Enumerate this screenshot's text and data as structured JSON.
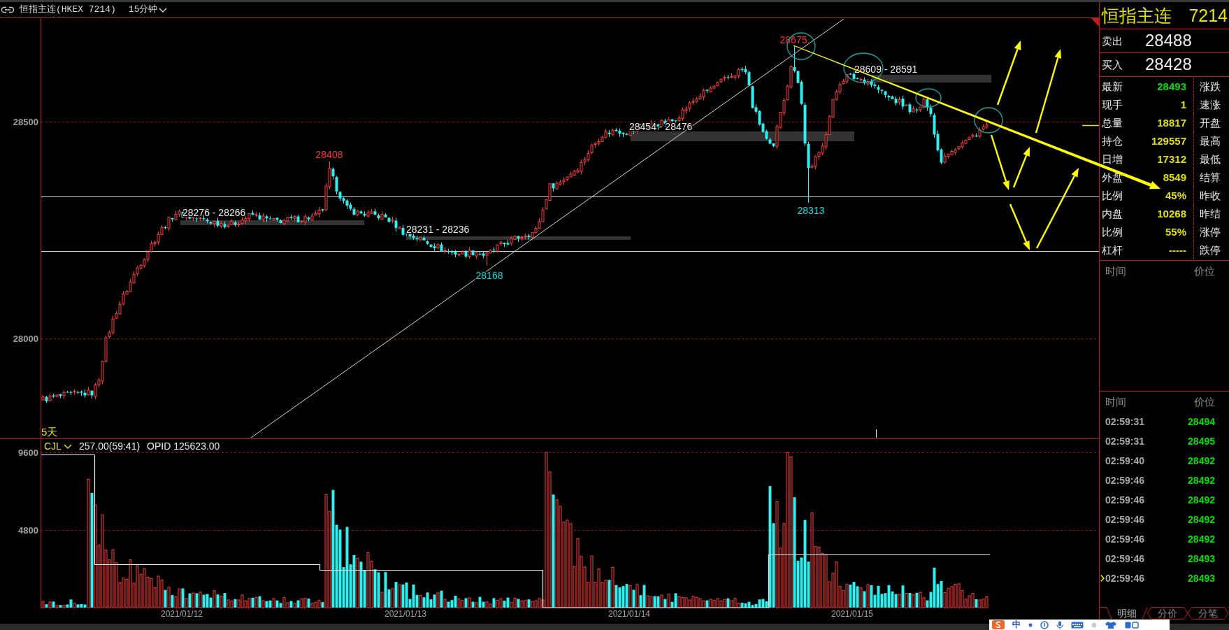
{
  "header": {
    "title": "恒指主连(HKEX 7214)",
    "period": "15分钟"
  },
  "price_chart": {
    "y_ticks": [
      "28500",
      "28000"
    ],
    "extreme_labels": [
      {
        "text": "28408",
        "kind": "high"
      },
      {
        "text": "28168",
        "kind": "low"
      },
      {
        "text": "28675",
        "kind": "high"
      },
      {
        "text": "28313",
        "kind": "low"
      }
    ],
    "range_labels": [
      "28276 - 28266",
      "28231 - 28236",
      "28454 - 28476",
      "28609 - 28591"
    ],
    "period_label": "5天"
  },
  "volume_chart": {
    "indicator": "CJL",
    "reading": "257.00(59:41)",
    "open_interest": "OPID 125623.00",
    "y_ticks": [
      "9600",
      "4800"
    ]
  },
  "x_axis": {
    "dates": [
      "2021/01/12",
      "2021/01/13",
      "2021/01/14",
      "2021/01/15"
    ]
  },
  "quote": {
    "name": "恒指主连",
    "code": "7214",
    "ask": {
      "label": "卖出",
      "value": "28488"
    },
    "bid": {
      "label": "买入",
      "value": "28428"
    },
    "rows": [
      {
        "label": "最新",
        "value": "28493",
        "color": "#00e000",
        "label_2": "涨跌"
      },
      {
        "label": "现手",
        "value": "1",
        "color": "#e0e000",
        "label_2": "速涨"
      },
      {
        "label": "总量",
        "value": "18817",
        "color": "#e0e000",
        "label_2": "开盘"
      },
      {
        "label": "持仓",
        "value": "129557",
        "color": "#e0e000",
        "label_2": "最高"
      },
      {
        "label": "日增",
        "value": "17312",
        "color": "#e0e000",
        "label_2": "最低"
      },
      {
        "label": "外盘",
        "value": "8549",
        "color": "#e0e000",
        "label_2": "结算"
      },
      {
        "label": "比例",
        "value": "45%",
        "color": "#e0e000",
        "label_2": "昨收"
      },
      {
        "label": "内盘",
        "value": "10268",
        "color": "#e0e000",
        "label_2": "昨结"
      },
      {
        "label": "比例",
        "value": "55%",
        "color": "#e0e000",
        "label_2": "涨停"
      },
      {
        "label": "杠杆",
        "value": "-----",
        "color": "#e0e000",
        "label_2": "跌停"
      }
    ]
  },
  "top_list": {
    "columns": [
      "时间",
      "价位"
    ]
  },
  "time_sales": {
    "columns": [
      "时间",
      "价位"
    ],
    "rows": [
      {
        "time": "02:59:31",
        "price": "28494",
        "selected": false
      },
      {
        "time": "02:59:31",
        "price": "28495",
        "selected": false
      },
      {
        "time": "02:59:40",
        "price": "28492",
        "selected": false
      },
      {
        "time": "02:59:46",
        "price": "28492",
        "selected": false
      },
      {
        "time": "02:59:46",
        "price": "28492",
        "selected": false
      },
      {
        "time": "02:59:46",
        "price": "28492",
        "selected": false
      },
      {
        "time": "02:59:46",
        "price": "28492",
        "selected": false
      },
      {
        "time": "02:59:46",
        "price": "28493",
        "selected": false
      },
      {
        "time": "02:59:46",
        "price": "28493",
        "selected": true
      }
    ]
  },
  "tabs": [
    {
      "label": "明细",
      "selected": true
    },
    {
      "label": "分价",
      "selected": false
    },
    {
      "label": "分笔",
      "selected": false
    }
  ],
  "taskbar": {
    "input_mode": "中"
  }
}
